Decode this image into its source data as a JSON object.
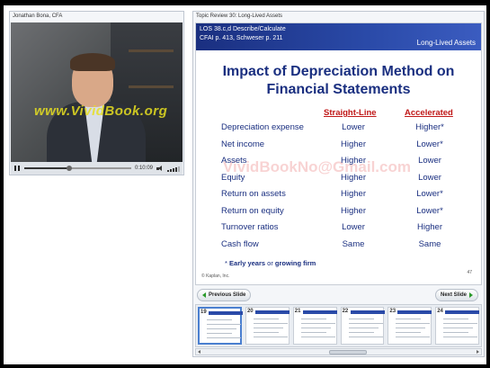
{
  "video": {
    "presenter": "Jonathan Bona, CFA",
    "watermark": "www.VividBook.org",
    "time": "0:10:09",
    "progress": 0.42,
    "volume_level": 0.8
  },
  "slide_panel": {
    "topic": "Topic Review 30: Long-Lived Assets"
  },
  "slide": {
    "los_line1": "LOS 38.c,d Describe/Calculate",
    "los_line2": "CFAI p. 413, Schweser p. 211",
    "section": "Long-Lived Assets",
    "title_line1": "Impact of Depreciation Method on",
    "title_line2": "Financial Statements",
    "col_straight_line": "Straight-Line",
    "col_accelerated": "Accelerated",
    "rows": [
      {
        "label": "Depreciation expense",
        "straight_line": "Lower",
        "accelerated": "Higher*"
      },
      {
        "label": "Net income",
        "straight_line": "Higher",
        "accelerated": "Lower*"
      },
      {
        "label": "Assets",
        "straight_line": "Higher",
        "accelerated": "Lower"
      },
      {
        "label": "Equity",
        "straight_line": "Higher",
        "accelerated": "Lower"
      },
      {
        "label": "Return on assets",
        "straight_line": "Higher",
        "accelerated": "Lower*"
      },
      {
        "label": "Return on equity",
        "straight_line": "Higher",
        "accelerated": "Lower*"
      },
      {
        "label": "Turnover ratios",
        "straight_line": "Lower",
        "accelerated": "Higher"
      },
      {
        "label": "Cash flow",
        "straight_line": "Same",
        "accelerated": "Same"
      }
    ],
    "footnote_prefix": "* ",
    "footnote_early": "Early years",
    "footnote_or": " or ",
    "footnote_growing": "growing firm",
    "copyright": "© Kaplan, Inc.",
    "page": "47",
    "watermark": "VividBookNo@Gmail.com"
  },
  "nav": {
    "previous": "Previous Slide",
    "next": "Next Slide"
  },
  "thumbnails": [
    "19",
    "20",
    "21",
    "22",
    "23",
    "24"
  ],
  "active_thumbnail": "19",
  "colors": {
    "header_blue": "#1a2f80",
    "column_red": "#c01818",
    "nav_arrow_green": "#2a9a2a"
  }
}
